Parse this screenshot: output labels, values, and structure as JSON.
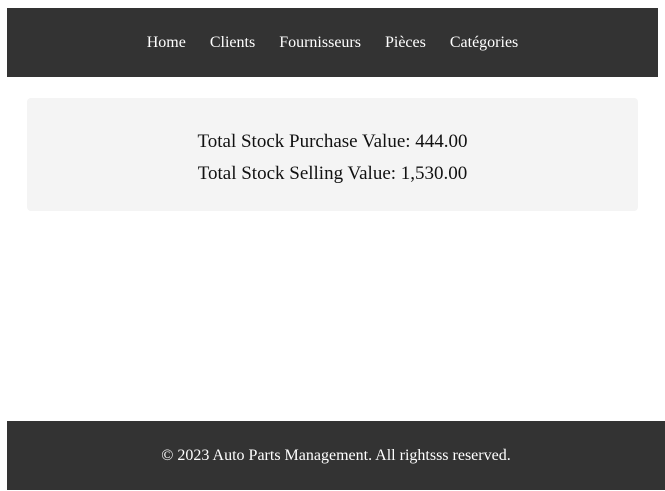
{
  "nav": {
    "items": [
      {
        "label": "Home"
      },
      {
        "label": "Clients"
      },
      {
        "label": "Fournisseurs"
      },
      {
        "label": "Pièces"
      },
      {
        "label": "Catégories"
      }
    ]
  },
  "summary": {
    "purchase_label": "Total Stock Purchase Value:",
    "purchase_value": "444.00",
    "selling_label": "Total Stock Selling Value:",
    "selling_value": "1,530.00"
  },
  "footer": {
    "text": "© 2023 Auto Parts Management. All rightsss reserved."
  },
  "colors": {
    "header_bg": "#333333",
    "card_bg": "#f4f4f4",
    "text_light": "#ffffff"
  }
}
